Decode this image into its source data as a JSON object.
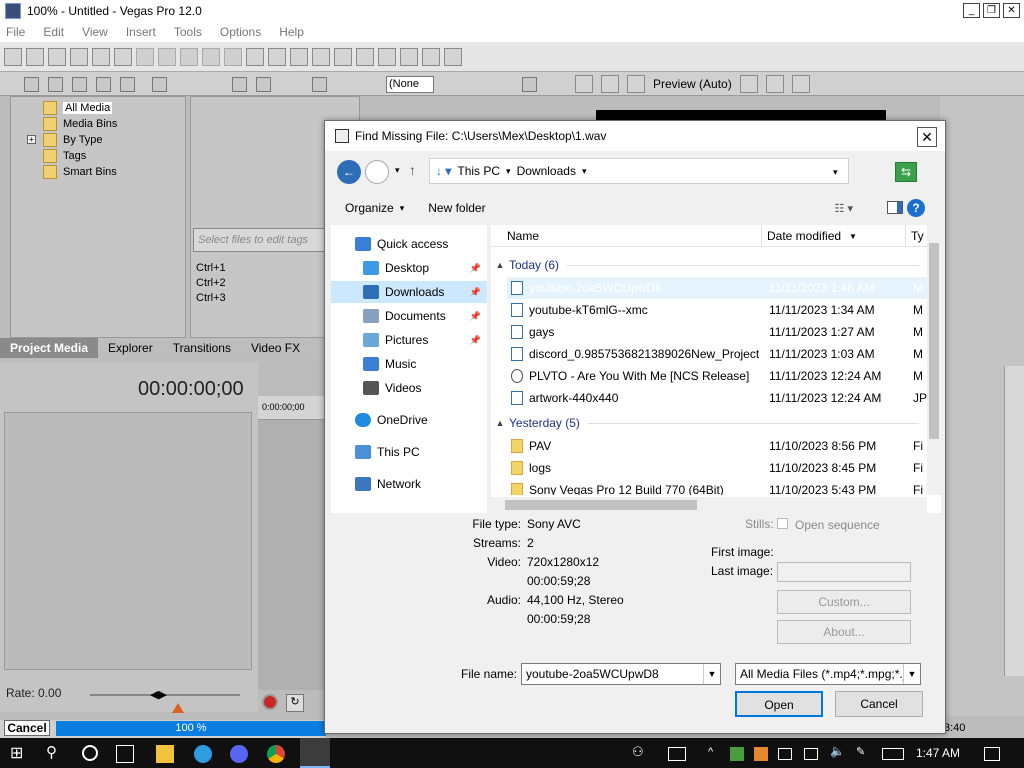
{
  "app": {
    "title": "100% - Untitled - Vegas Pro 12.0",
    "menu": [
      "File",
      "Edit",
      "View",
      "Insert",
      "Tools",
      "Options",
      "Help"
    ]
  },
  "project_media": {
    "tree": [
      "All Media",
      "Media Bins",
      "By Type",
      "Tags",
      "Smart Bins"
    ],
    "tag_placeholder": "Select files to edit tags",
    "shortcuts": [
      "Ctrl+1",
      "Ctrl+2",
      "Ctrl+3"
    ],
    "tabs": [
      "Project Media",
      "Explorer",
      "Transitions",
      "Video FX"
    ],
    "active_tab": "Project Media"
  },
  "editor": {
    "timecode": "00:00:00;00",
    "ruler_time": "0:00:00;00",
    "rate_label": "Rate: 0.00",
    "cancel_label": "Cancel",
    "progress_label": "100 %",
    "progress_fraction": 1.0,
    "preview_none": "(None",
    "preview_mode": "Preview (Auto)",
    "time_right": "3:40"
  },
  "dialog": {
    "title": "Find Missing File: C:\\Users\\Mex\\Desktop\\1.wav",
    "breadcrumb": [
      "This PC",
      "Downloads"
    ],
    "organize": "Organize",
    "new_folder": "New folder",
    "help": "?",
    "nav": [
      {
        "label": "Quick access",
        "icon": "star-icon",
        "pinned": false
      },
      {
        "label": "Desktop",
        "icon": "desktop-icon",
        "pinned": true
      },
      {
        "label": "Downloads",
        "icon": "download-icon",
        "pinned": true,
        "selected": true
      },
      {
        "label": "Documents",
        "icon": "documents-icon",
        "pinned": true
      },
      {
        "label": "Pictures",
        "icon": "pictures-icon",
        "pinned": true
      },
      {
        "label": "Music",
        "icon": "music-icon",
        "pinned": false
      },
      {
        "label": "Videos",
        "icon": "videos-icon",
        "pinned": false
      },
      {
        "label": "OneDrive",
        "icon": "cloud-icon",
        "pinned": false
      },
      {
        "label": "This PC",
        "icon": "computer-icon",
        "pinned": false
      },
      {
        "label": "Network",
        "icon": "network-icon",
        "pinned": false
      }
    ],
    "columns": {
      "name": "Name",
      "date": "Date modified",
      "type": "Ty"
    },
    "groups": [
      {
        "label": "Today (6)",
        "files": [
          {
            "name": "youtube-2oa5WCUpwD8",
            "date": "11/11/2023 1:46 AM",
            "type": "M",
            "kind": "video",
            "highlighted": true
          },
          {
            "name": "youtube-kT6mlG--xmc",
            "date": "11/11/2023 1:34 AM",
            "type": "M",
            "kind": "video"
          },
          {
            "name": "gays",
            "date": "11/11/2023 1:27 AM",
            "type": "M",
            "kind": "video"
          },
          {
            "name": "discord_0.9857536821389026New_Project...",
            "date": "11/11/2023 1:03 AM",
            "type": "M",
            "kind": "video"
          },
          {
            "name": "PLVTO - Are You With Me [NCS Release]",
            "date": "11/11/2023 12:24 AM",
            "type": "M",
            "kind": "audio"
          },
          {
            "name": "artwork-440x440",
            "date": "11/11/2023 12:24 AM",
            "type": "JP",
            "kind": "image"
          }
        ]
      },
      {
        "label": "Yesterday (5)",
        "files": [
          {
            "name": "PAV",
            "date": "11/10/2023 8:56 PM",
            "type": "Fi",
            "kind": "folder"
          },
          {
            "name": "logs",
            "date": "11/10/2023 8:45 PM",
            "type": "Fi",
            "kind": "folder"
          },
          {
            "name": "Sony Vegas Pro 12 Build 770 (64Bit)",
            "date": "11/10/2023 5:43 PM",
            "type": "Fi",
            "kind": "folder"
          }
        ]
      }
    ],
    "info": {
      "file_type_label": "File type:",
      "file_type": "Sony AVC",
      "streams_label": "Streams:",
      "streams": "2",
      "video_label": "Video:",
      "video_res": "720x1280x12",
      "video_dur": "00:00:59;28",
      "audio_label": "Audio:",
      "audio_fmt": "44,100 Hz, Stereo",
      "audio_dur": "00:00:59;28",
      "stills_label": "Stills:",
      "open_sequence": "Open sequence",
      "first_image_label": "First image:",
      "last_image_label": "Last image:",
      "custom_btn": "Custom...",
      "about_btn": "About..."
    },
    "file_name_label": "File name:",
    "file_name_value": "youtube-2oa5WCUpwD8",
    "file_type_filter": "All Media Files (*.mp4;*.mpg;*.j",
    "open_btn": "Open",
    "cancel_btn": "Cancel"
  },
  "taskbar": {
    "time": "1:47 AM"
  },
  "colors": {
    "accent": "#0078d7",
    "selection": "#cce8ff",
    "progress": "#0a7ee0"
  }
}
